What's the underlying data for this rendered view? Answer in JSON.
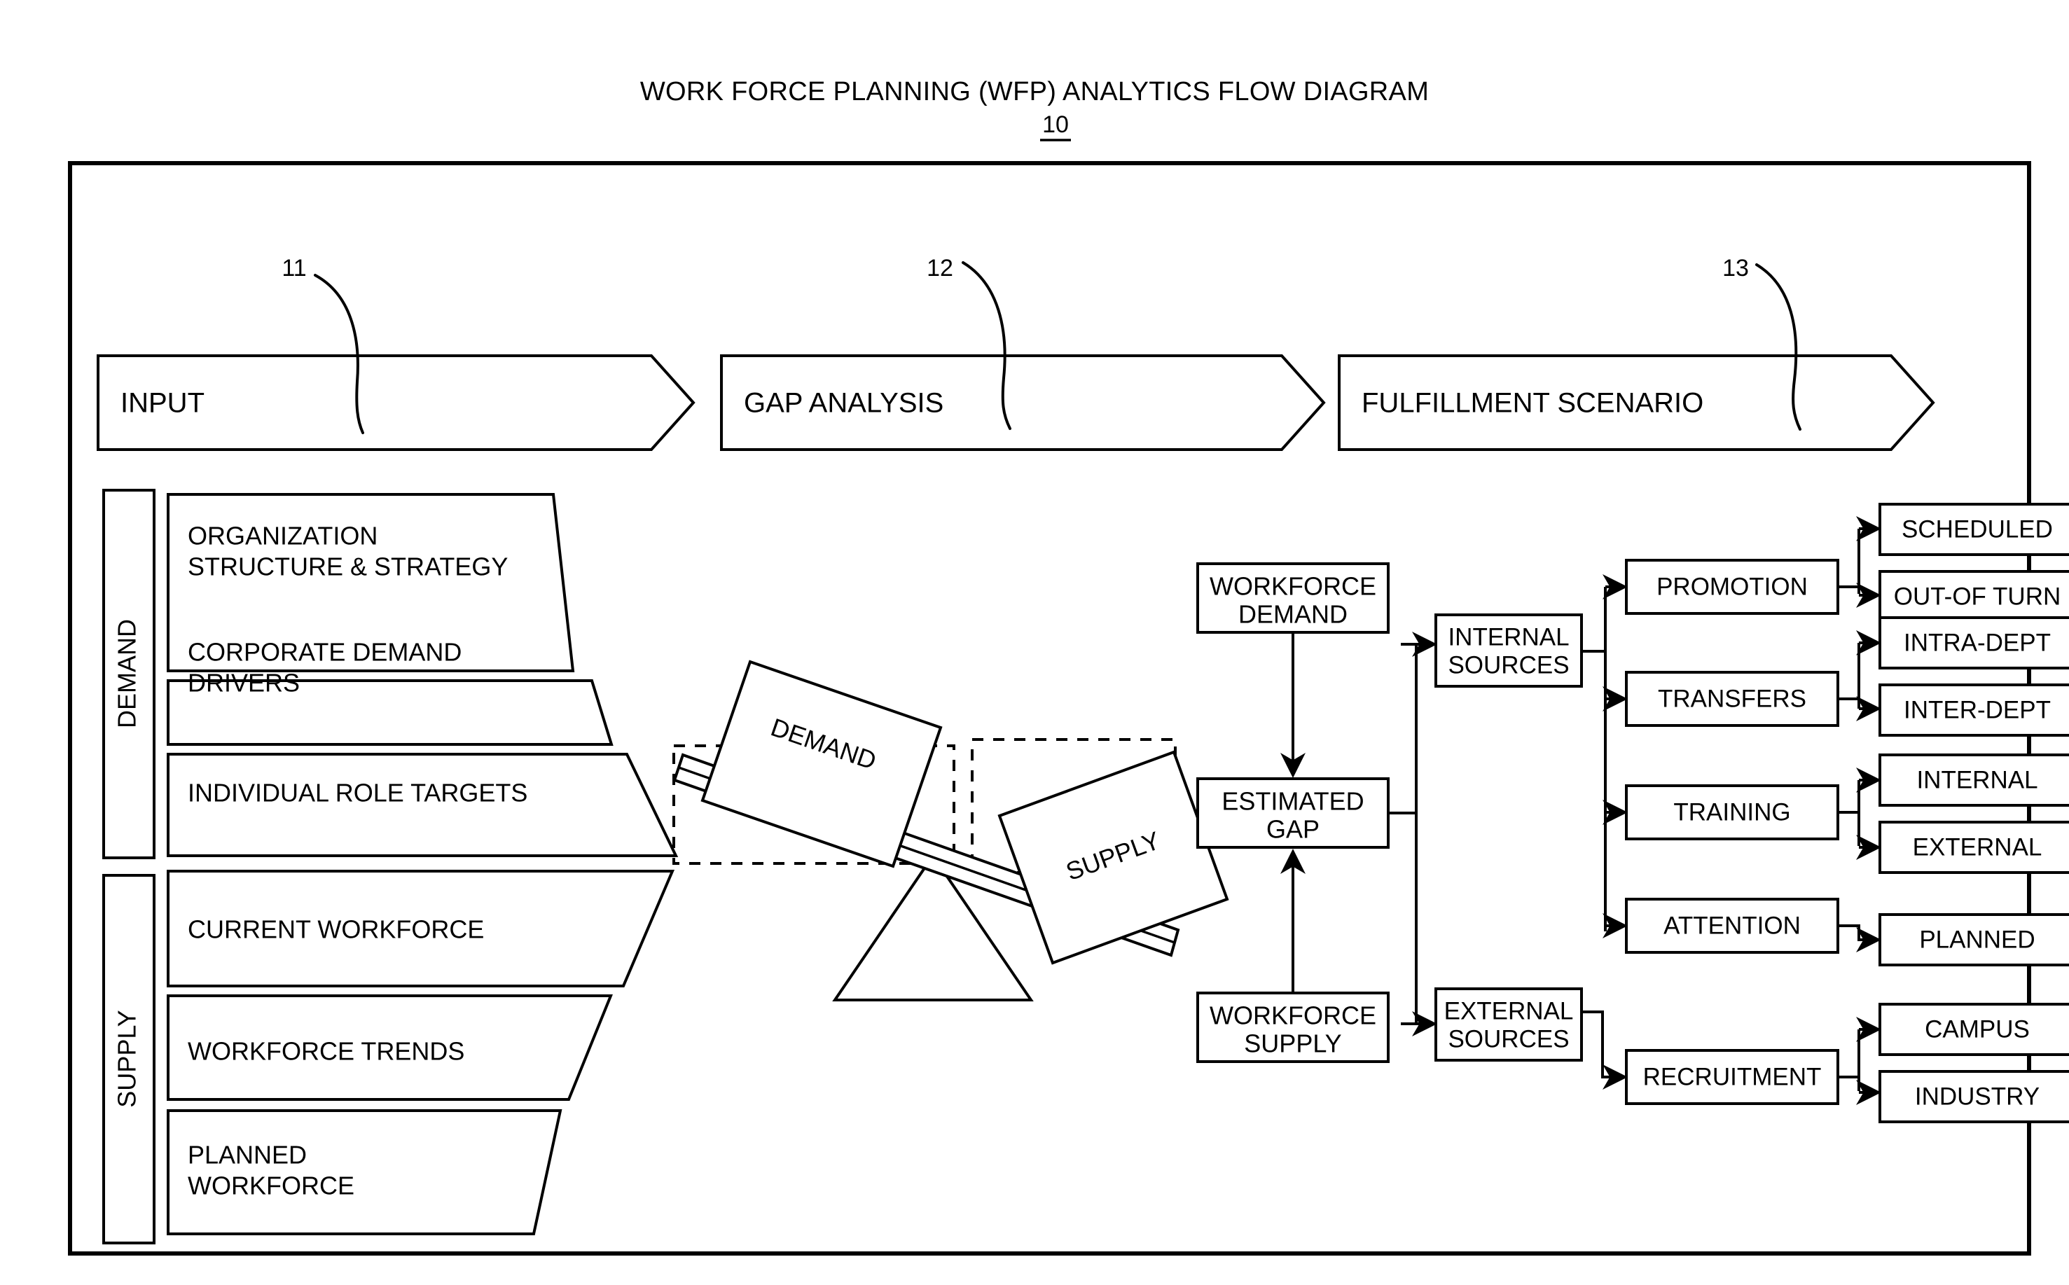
{
  "title": {
    "text": "WORK FORCE PLANNING (WFP) ANALYTICS FLOW DIAGRAM",
    "ref": "10"
  },
  "banners": [
    {
      "label": "INPUT",
      "ref": "11"
    },
    {
      "label": "GAP ANALYSIS",
      "ref": "12"
    },
    {
      "label": "FULFILLMENT SCENARIO",
      "ref": "13"
    }
  ],
  "input_section": {
    "demand": {
      "side_label": "DEMAND",
      "items": [
        {
          "line1": "ORGANIZATION",
          "line2": "STRUCTURE & STRATEGY"
        },
        {
          "line1": "CORPORATE DEMAND",
          "line2": "DRIVERS"
        },
        {
          "line1": "INDIVIDUAL ROLE TARGETS",
          "line2": ""
        }
      ]
    },
    "supply": {
      "side_label": "SUPPLY",
      "items": [
        {
          "line1": "CURRENT WORKFORCE",
          "line2": ""
        },
        {
          "line1": "WORKFORCE TRENDS",
          "line2": ""
        },
        {
          "line1": "PLANNED",
          "line2": "WORKFORCE"
        }
      ]
    }
  },
  "seesaw": {
    "left_plate_label": "DEMAND",
    "right_plate_label": "SUPPLY"
  },
  "gap_analysis": {
    "workforce_demand": {
      "line1": "WORKFORCE",
      "line2": "DEMAND"
    },
    "estimated_gap": {
      "line1": "ESTIMATED",
      "line2": "GAP"
    },
    "workforce_supply": {
      "line1": "WORKFORCE",
      "line2": "SUPPLY"
    }
  },
  "fulfillment": {
    "sources": [
      {
        "line1": "INTERNAL",
        "line2": "SOURCES"
      },
      {
        "line1": "EXTERNAL",
        "line2": "SOURCES"
      }
    ],
    "internal_methods": [
      {
        "label": "PROMOTION",
        "outcomes": [
          "SCHEDULED",
          "OUT-OF TURN"
        ]
      },
      {
        "label": "TRANSFERS",
        "outcomes": [
          "INTRA-DEPT",
          "INTER-DEPT"
        ]
      },
      {
        "label": "TRAINING",
        "outcomes": [
          "INTERNAL",
          "EXTERNAL"
        ]
      },
      {
        "label": "ATTENTION",
        "outcomes": [
          "PLANNED"
        ]
      }
    ],
    "external_methods": [
      {
        "label": "RECRUITMENT",
        "outcomes": [
          "CAMPUS",
          "INDUSTRY"
        ]
      }
    ]
  },
  "colors": {
    "stroke": "#000000",
    "background": "#ffffff"
  }
}
